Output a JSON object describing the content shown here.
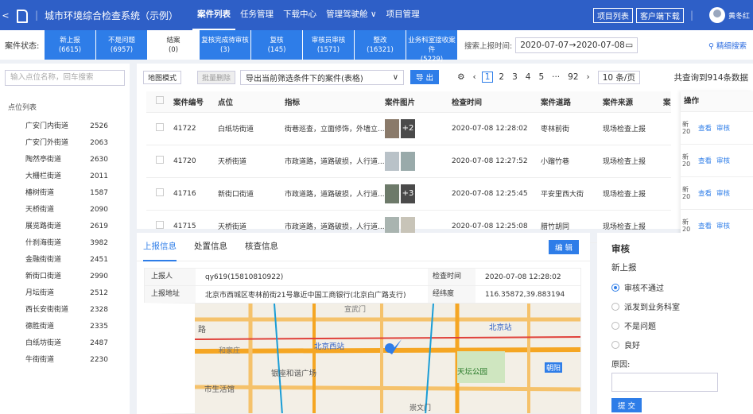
{
  "header": {
    "back": "<",
    "title": "城市环境综合检查系统（示例）",
    "nav": [
      "案件列表",
      "任务管理",
      "下载中心",
      "管理驾驶舱 ∨",
      "项目管理"
    ],
    "btn_projects": "项目列表",
    "btn_client": "客户端下载",
    "username": "黄冬红"
  },
  "status_bar": {
    "label": "案件状态:",
    "tabs": [
      {
        "name": "新上报",
        "count": "(6615)"
      },
      {
        "name": "不是问题",
        "count": "(6957)"
      },
      {
        "name": "结案",
        "count": "(0)"
      },
      {
        "name": "复核完成待审核",
        "count": "(3)"
      },
      {
        "name": "复核",
        "count": "(145)"
      },
      {
        "name": "审核员审核",
        "count": "(1571)"
      },
      {
        "name": "整改",
        "count": "(16321)"
      },
      {
        "name": "业务科室接收案件",
        "count": "(5229)"
      }
    ],
    "date_label": "搜索上报时间:",
    "date_start": "2020-07-07",
    "date_arrow": "→",
    "date_end": "2020-07-08",
    "fine_search": "精细搜索"
  },
  "left_panel": {
    "search_placeholder": "输入点位名称，回车搜索",
    "list_label": "点位列表",
    "items": [
      {
        "name": "广安门内街道",
        "count": "2526"
      },
      {
        "name": "广安门外街道",
        "count": "2063"
      },
      {
        "name": "陶然亭街道",
        "count": "2630"
      },
      {
        "name": "大栅栏街道",
        "count": "2011"
      },
      {
        "name": "椿树街道",
        "count": "1587"
      },
      {
        "name": "天桥街道",
        "count": "2090"
      },
      {
        "name": "展览路街道",
        "count": "2619"
      },
      {
        "name": "什刹海街道",
        "count": "3982"
      },
      {
        "name": "金融街街道",
        "count": "2451"
      },
      {
        "name": "新街口街道",
        "count": "2990"
      },
      {
        "name": "月坛街道",
        "count": "2512"
      },
      {
        "name": "西长安街街道",
        "count": "2328"
      },
      {
        "name": "德胜街道",
        "count": "2335"
      },
      {
        "name": "白纸坊街道",
        "count": "2487"
      },
      {
        "name": "牛街街道",
        "count": "2230"
      }
    ]
  },
  "toolbar": {
    "map_mode": "地图模式",
    "batch_delete": "批量删除",
    "export_select": "导出当前筛选条件下的案件(表格)",
    "export_btn": "导 出",
    "pages": [
      "1",
      "2",
      "3",
      "4",
      "5",
      "···",
      "92"
    ],
    "page_size": "10 条/页",
    "total": "共查询到914条数据"
  },
  "table": {
    "headers": [
      "案件编号",
      "点位",
      "指标",
      "案件图片",
      "检查时间",
      "案件道路",
      "案件来源",
      "案",
      "操作"
    ],
    "rows": [
      {
        "id": "41722",
        "site": "白纸坊街道",
        "indicator": "街巷巡查，立面修饰，外墙立...",
        "extra": "+2",
        "time": "2020-07-08 12:28:02",
        "road": "枣林前街",
        "source": "现场检查上报",
        "trunc": "新20"
      },
      {
        "id": "41720",
        "site": "天桥街道",
        "indicator": "市政道路，道路破损，人行道...",
        "extra": "",
        "time": "2020-07-08 12:27:52",
        "road": "小蹓竹巷",
        "source": "现场检查上报",
        "trunc": "新20"
      },
      {
        "id": "41716",
        "site": "新街口街道",
        "indicator": "市政道路，道路破损，人行道...",
        "extra": "+3",
        "time": "2020-07-08 12:25:45",
        "road": "平安里西大街",
        "source": "现场检查上报",
        "trunc": "新20"
      },
      {
        "id": "41715",
        "site": "天桥街道",
        "indicator": "市政道路，道路破损，人行道...",
        "extra": "",
        "time": "2020-07-08 12:25:08",
        "road": "腊竹胡同",
        "source": "现场检查上报",
        "trunc": "新20"
      }
    ],
    "op_view": "查看",
    "op_review": "审核"
  },
  "detail": {
    "tabs": [
      "上报信息",
      "处置信息",
      "核查信息"
    ],
    "edit_btn": "编 辑",
    "reporter_label": "上报人",
    "reporter": "qy619(15810810922)",
    "check_time_label": "检查时间",
    "check_time": "2020-07-08 12:28:02",
    "address_label": "上报地址",
    "address": "北京市西城区枣林前街21号靠近中国工商银行(北京白广路支行)",
    "coords_label": "经纬度",
    "coords": "116.35872,39.883194",
    "map_labels": [
      "路",
      "北京西站",
      "北京站",
      "天坛公园",
      "银座和谐广场",
      "和家庄",
      "宣武门",
      "朝阳",
      "市生活馆",
      "崇文门"
    ]
  },
  "review": {
    "title": "审核",
    "status": "新上报",
    "options": [
      "审核不通过",
      "派发到业务科室",
      "不是问题",
      "良好"
    ],
    "reason_label": "原因:",
    "submit": "提 交"
  }
}
